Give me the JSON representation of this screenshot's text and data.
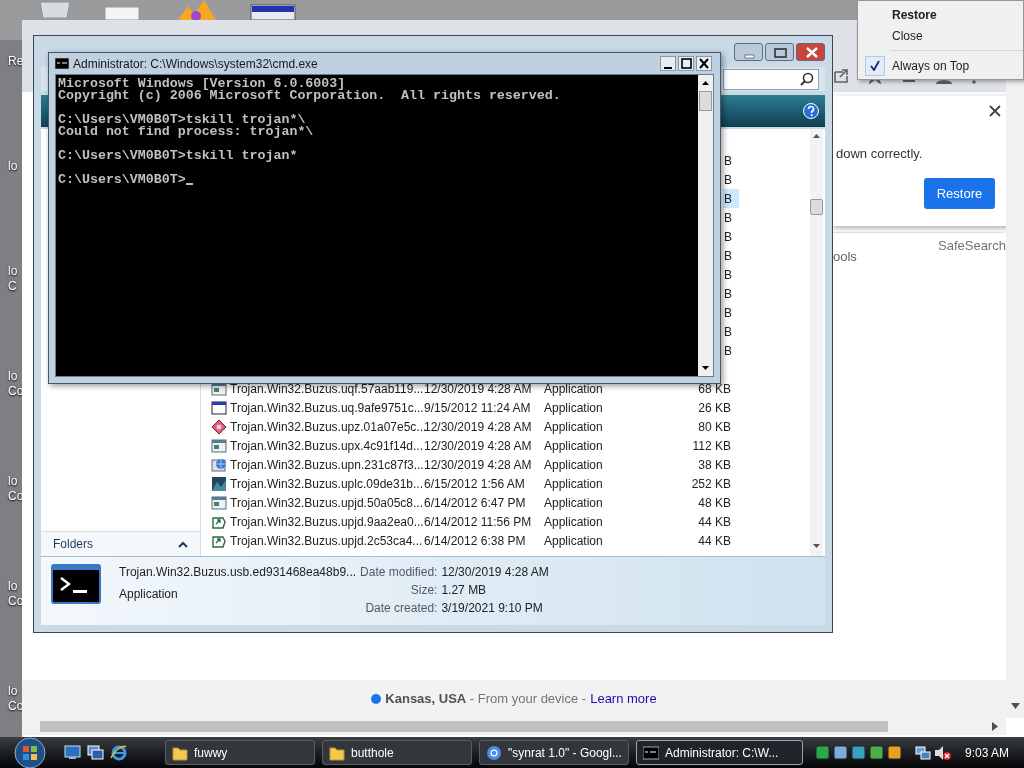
{
  "desktop": {
    "icon_labels": [
      {
        "lines": [
          "Re"
        ]
      },
      {
        "lines": [
          "lo"
        ]
      },
      {
        "lines": [
          "lo",
          "C"
        ]
      },
      {
        "lines": [
          "lo",
          "Co"
        ]
      },
      {
        "lines": [
          "lo",
          "Co"
        ]
      },
      {
        "lines": [
          "lo",
          "Co"
        ]
      },
      {
        "lines": [
          "lo",
          "Co"
        ]
      }
    ]
  },
  "browser": {
    "notification": {
      "message": "down correctly.",
      "button": "Restore"
    },
    "tools_fragment": "ools",
    "safesearch": "SafeSearch",
    "footer": {
      "text": "**Kansas, USA** - From your device -",
      "link": "Learn more"
    }
  },
  "explorer": {
    "hidden_rows": [
      {
        "size": "B",
        "selected": false
      },
      {
        "size": "B",
        "selected": false
      },
      {
        "size": "B",
        "selected": true
      },
      {
        "size": "B",
        "selected": false
      },
      {
        "size": "B",
        "selected": false
      },
      {
        "size": "B",
        "selected": false
      },
      {
        "size": "B",
        "selected": false
      },
      {
        "size": "B",
        "selected": false
      },
      {
        "size": "B",
        "selected": false
      },
      {
        "size": "B",
        "selected": false
      },
      {
        "size": "B",
        "selected": false
      }
    ],
    "rows": [
      {
        "kind": "app",
        "name": "Trojan.Win32.Buzus.uqf.57aab119...",
        "date": "12/30/2019 4:28 AM",
        "type": "Application",
        "size": "68 KB"
      },
      {
        "kind": "window",
        "name": "Trojan.Win32.Buzus.uq.9afe9751c...",
        "date": "9/15/2012 11:24 AM",
        "type": "Application",
        "size": "26 KB"
      },
      {
        "kind": "diamond",
        "name": "Trojan.Win32.Buzus.upz.01a07e5c...",
        "date": "12/30/2019 4:28 AM",
        "type": "Application",
        "size": "80 KB"
      },
      {
        "kind": "app",
        "name": "Trojan.Win32.Buzus.upx.4c91f14d...",
        "date": "12/30/2019 4:28 AM",
        "type": "Application",
        "size": "112 KB"
      },
      {
        "kind": "globe",
        "name": "Trojan.Win32.Buzus.upn.231c87f3...",
        "date": "12/30/2019 4:28 AM",
        "type": "Application",
        "size": "38 KB"
      },
      {
        "kind": "image",
        "name": "Trojan.Win32.Buzus.uplc.09de31b...",
        "date": "6/15/2012 1:56 AM",
        "type": "Application",
        "size": "252 KB"
      },
      {
        "kind": "app",
        "name": "Trojan.Win32.Buzus.upjd.50a05c8...",
        "date": "6/14/2012 6:47 PM",
        "type": "Application",
        "size": "48 KB"
      },
      {
        "kind": "shortcut",
        "name": "Trojan.Win32.Buzus.upjd.9aa2ea0...",
        "date": "6/14/2012 11:56 PM",
        "type": "Application",
        "size": "44 KB"
      },
      {
        "kind": "shortcut",
        "name": "Trojan.Win32.Buzus.upjd.2c53ca4...",
        "date": "6/14/2012 6:38 PM",
        "type": "Application",
        "size": "44 KB"
      }
    ],
    "nav_pane": {
      "label": "Folders"
    },
    "details": {
      "name": "Trojan.Win32.Buzus.usb.ed931468ea48b9...",
      "type": "Application",
      "fields": [
        {
          "label": "Date modified:",
          "value": "12/30/2019 4:28 AM"
        },
        {
          "label": "Size:",
          "value": "1.27 MB"
        },
        {
          "label": "Date created:",
          "value": "3/19/2021 9:10 PM"
        }
      ]
    }
  },
  "console": {
    "title": "Administrator: C:\\Windows\\system32\\cmd.exe",
    "blocks": [
      [
        "Microsoft Windows [Version 6.0.6003]",
        "Copyright (c) 2006 Microsoft Corporation.  All rights reserved."
      ],
      [
        "C:\\Users\\VM0B0T>tskill trojan*\\",
        "Could not find process: trojan*\\"
      ],
      [
        "C:\\Users\\VM0B0T>tskill trojan*"
      ],
      [
        "C:\\Users\\VM0B0T>"
      ]
    ]
  },
  "context_menu": {
    "items": [
      {
        "label": "Restore",
        "default": true,
        "checked": false,
        "separator_before": false
      },
      {
        "label": "Close",
        "default": false,
        "checked": false,
        "separator_before": false
      },
      {
        "label": "Always on Top",
        "default": false,
        "checked": true,
        "separator_before": true
      }
    ]
  },
  "taskbar": {
    "buttons": [
      {
        "kind": "folder",
        "label": "fuwwy",
        "selected": false
      },
      {
        "kind": "folder",
        "label": "butthole",
        "selected": false
      },
      {
        "kind": "browser",
        "label": "\"synrat 1.0\" - Googl...",
        "selected": false
      },
      {
        "kind": "console",
        "label": "Administrator: C:\\W...",
        "selected": true
      }
    ],
    "clock": "9:03 AM"
  }
}
